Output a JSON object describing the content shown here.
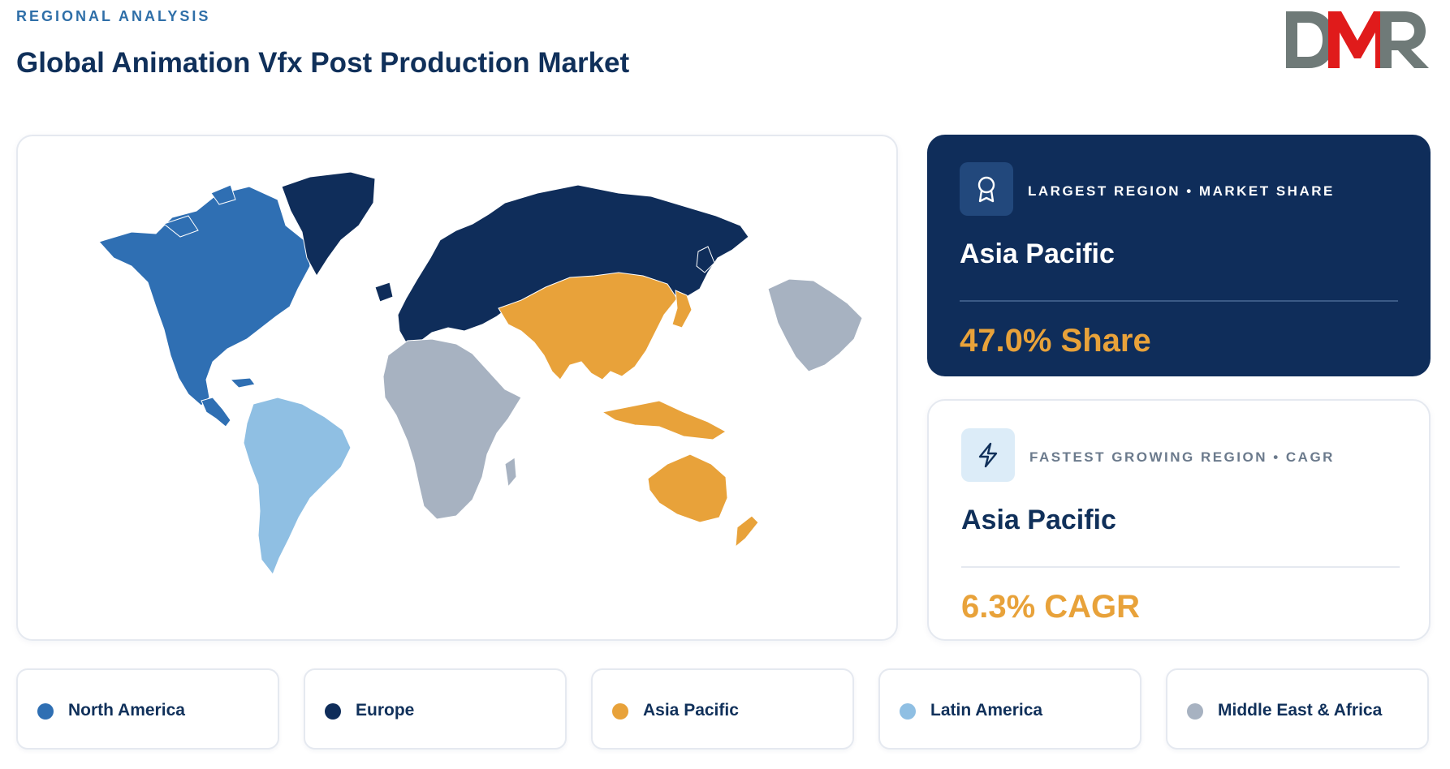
{
  "header": {
    "eyebrow": "REGIONAL ANALYSIS",
    "title": "Global Animation Vfx Post Production Market"
  },
  "logo": {
    "text": "DMR",
    "colors": {
      "d": "#6f7a78",
      "m": "#e01b1b",
      "r": "#6f7a78"
    }
  },
  "map": {
    "regions": [
      {
        "name": "North America",
        "color": "#2f6fb3"
      },
      {
        "name": "Europe",
        "color": "#0f2d5a"
      },
      {
        "name": "Asia Pacific",
        "color": "#e8a23a"
      },
      {
        "name": "Latin America",
        "color": "#8fbfe3"
      },
      {
        "name": "Middle East & Africa",
        "color": "#a7b2c1"
      }
    ]
  },
  "largest": {
    "icon": "award-ribbon-icon",
    "label": "LARGEST REGION • MARKET SHARE",
    "region": "Asia Pacific",
    "value": "47.0% Share"
  },
  "fastest": {
    "icon": "lightning-bolt-icon",
    "label": "FASTEST GROWING REGION • CAGR",
    "region": "Asia Pacific",
    "value": "6.3% CAGR"
  },
  "legend": [
    {
      "label": "North America",
      "color": "#2f6fb3"
    },
    {
      "label": "Europe",
      "color": "#0f2d5a"
    },
    {
      "label": "Asia Pacific",
      "color": "#e8a23a"
    },
    {
      "label": "Latin America",
      "color": "#8fbfe3"
    },
    {
      "label": "Middle East & Africa",
      "color": "#a7b2c1"
    }
  ]
}
